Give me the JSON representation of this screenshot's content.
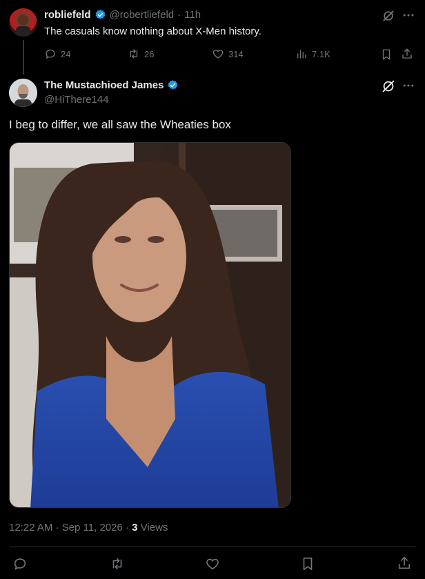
{
  "parent_tweet": {
    "display_name": "robliefeld",
    "handle": "@robertliefeld",
    "separator": "·",
    "time_ago": "11h",
    "text": "The casuals know nothing about X-Men history.",
    "replies": "24",
    "reposts": "26",
    "likes": "314",
    "views": "7.1K"
  },
  "reply_tweet": {
    "display_name": "The Mustachioed James",
    "handle": "@HiThere144",
    "text": "I beg to differ, we all saw the Wheaties box",
    "timestamp": "12:22 AM · Sep 11, 2026 · ",
    "views_count": "3",
    "views_label": " Views"
  },
  "icons": {
    "verified": "verified-badge-icon",
    "grok": "grok-icon",
    "more": "more-icon",
    "reply": "reply-icon",
    "repost": "repost-icon",
    "like": "heart-icon",
    "views": "views-chart-icon",
    "bookmark": "bookmark-icon",
    "share": "share-icon"
  },
  "colors": {
    "background": "#000000",
    "text": "#e7e9ea",
    "muted": "#71767b",
    "verified": "#1d9bf0",
    "divider": "#2f3336"
  }
}
